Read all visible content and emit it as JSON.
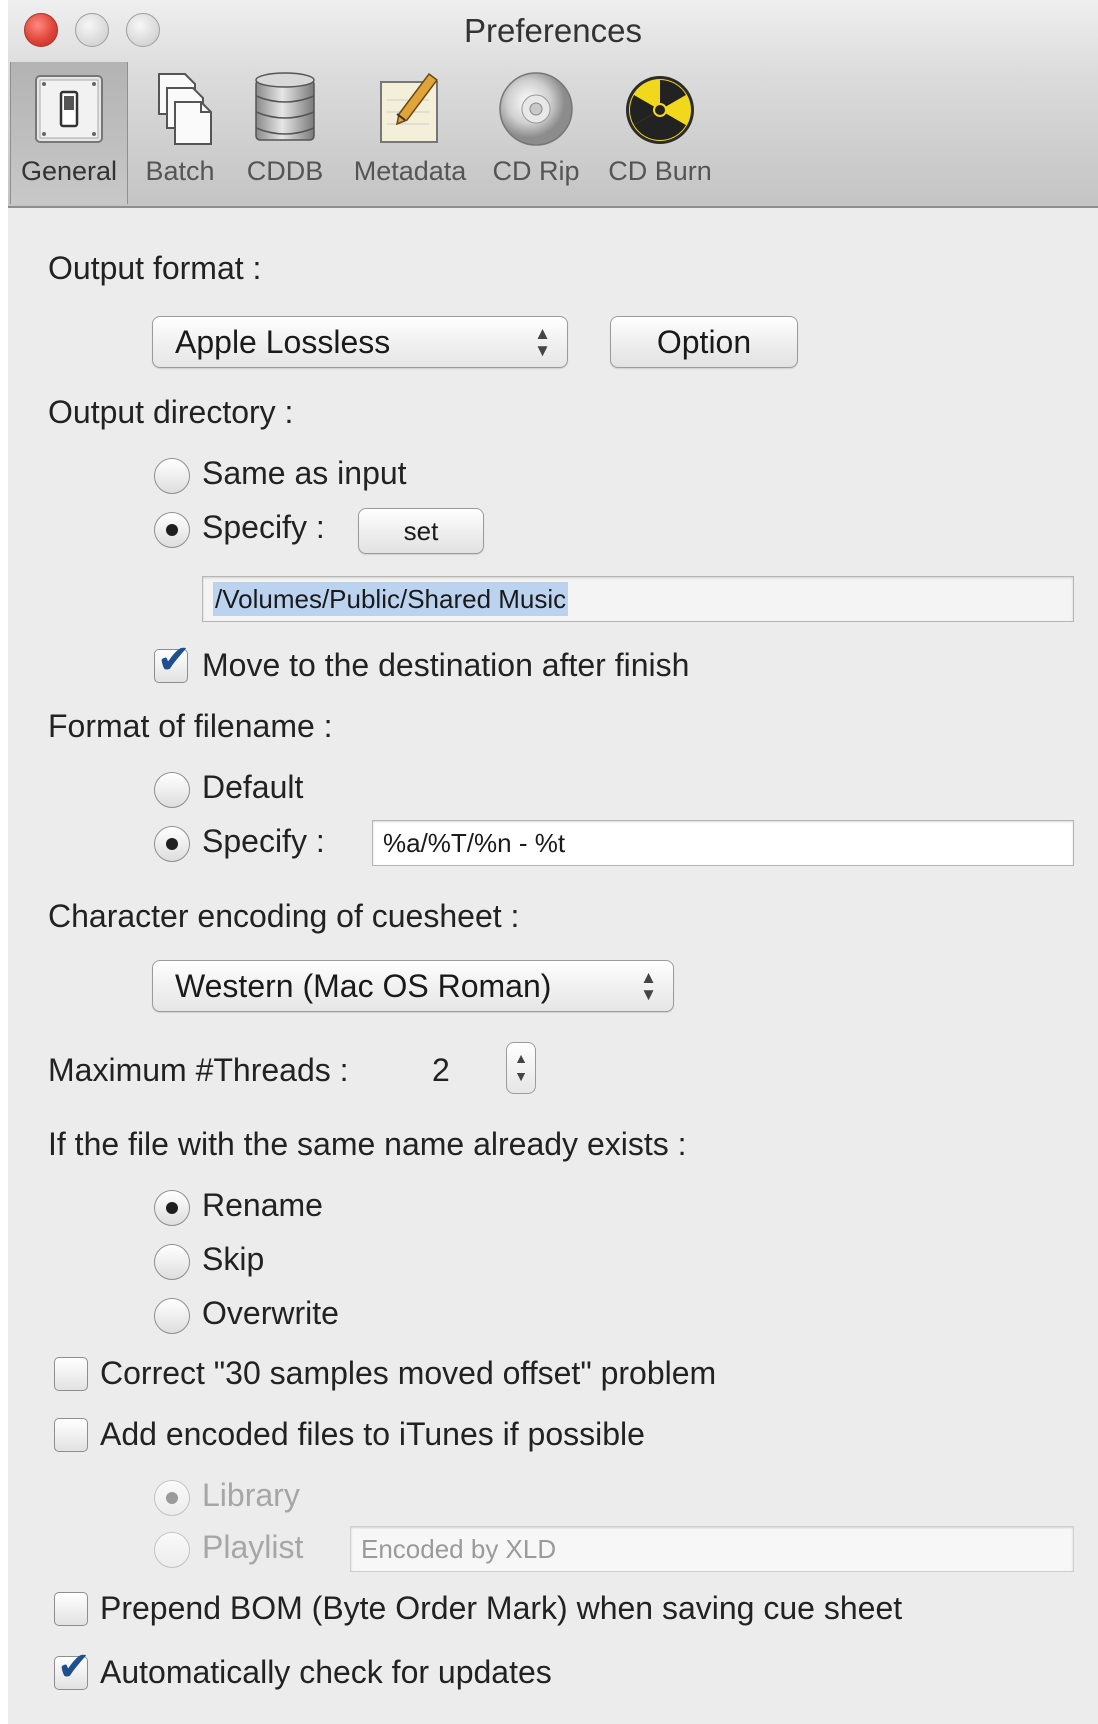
{
  "window": {
    "title": "Preferences"
  },
  "toolbar": {
    "items": [
      {
        "label": "General",
        "icon": "general-switch-icon",
        "active": true
      },
      {
        "label": "Batch",
        "icon": "batch-documents-icon",
        "active": false
      },
      {
        "label": "CDDB",
        "icon": "database-icon",
        "active": false
      },
      {
        "label": "Metadata",
        "icon": "metadata-pencil-icon",
        "active": false
      },
      {
        "label": "CD Rip",
        "icon": "cd-disc-icon",
        "active": false
      },
      {
        "label": "CD Burn",
        "icon": "radiation-icon",
        "active": false
      }
    ]
  },
  "output_format": {
    "label": "Output format :",
    "selected": "Apple Lossless",
    "option_button": "Option"
  },
  "output_directory": {
    "label": "Output directory :",
    "same_as_input": "Same as input",
    "specify": "Specify :",
    "set_button": "set",
    "path": "/Volumes/Public/Shared Music",
    "move_after_finish": "Move to the destination after finish",
    "move_checked": true,
    "selected": "specify"
  },
  "filename_format": {
    "label": "Format of filename :",
    "default": "Default",
    "specify": "Specify :",
    "pattern": "%a/%T/%n - %t",
    "selected": "specify"
  },
  "cuesheet_encoding": {
    "label": "Character encoding of cuesheet :",
    "selected": "Western (Mac OS Roman)"
  },
  "threads": {
    "label": "Maximum #Threads :",
    "value": "2"
  },
  "existing_file": {
    "label": "If the file with the same name already exists :",
    "options": [
      "Rename",
      "Skip",
      "Overwrite"
    ],
    "selected": "Rename"
  },
  "correct_offset": {
    "label": "Correct \"30 samples moved offset\" problem",
    "checked": false
  },
  "itunes": {
    "label": "Add encoded files to iTunes if possible",
    "checked": false,
    "library": "Library",
    "playlist": "Playlist",
    "playlist_name": "Encoded by XLD"
  },
  "prepend_bom": {
    "label": "Prepend BOM (Byte Order Mark) when saving cue sheet",
    "checked": false
  },
  "auto_update": {
    "label": "Automatically check for updates",
    "checked": true
  },
  "colors": {
    "check_mark": "#1e4f8e",
    "selection": "#bcd3f0",
    "close_button": "#e0463a"
  }
}
